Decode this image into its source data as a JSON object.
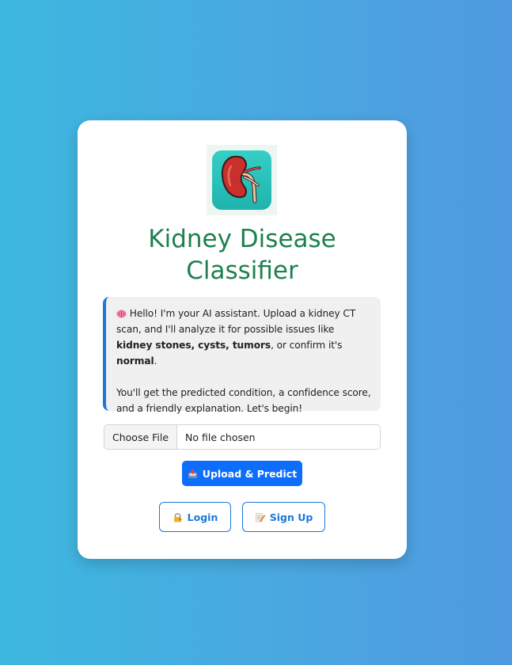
{
  "app": {
    "title_line1": "Kidney Disease",
    "title_line2": "Classifier",
    "logo_icon": "kidney-logo-icon"
  },
  "assistant": {
    "icon": "brain-icon",
    "p1_text1": " Hello! I'm your AI assistant. Upload a kidney CT scan, and I'll analyze it for possible issues like ",
    "p1_bold1": "kidney stones, cysts, tumors",
    "p1_text2": ", or confirm it's ",
    "p1_bold2": "normal",
    "p1_text3": ".",
    "p2": "You'll get the predicted condition, a confidence score, and a friendly explanation. Let's begin!"
  },
  "file_input": {
    "button_label": "Choose File",
    "status": "No file chosen"
  },
  "actions": {
    "upload_label": "Upload & Predict",
    "upload_icon": "inbox-tray-icon",
    "login_label": "Login",
    "login_icon": "lock-key-icon",
    "signup_label": "Sign Up",
    "signup_icon": "memo-icon"
  },
  "colors": {
    "title": "#1e8050",
    "accent": "#1e77d8",
    "primary": "#0d6efd",
    "logo_bg": "#2cc3bc",
    "kidney": "#c9302c"
  }
}
